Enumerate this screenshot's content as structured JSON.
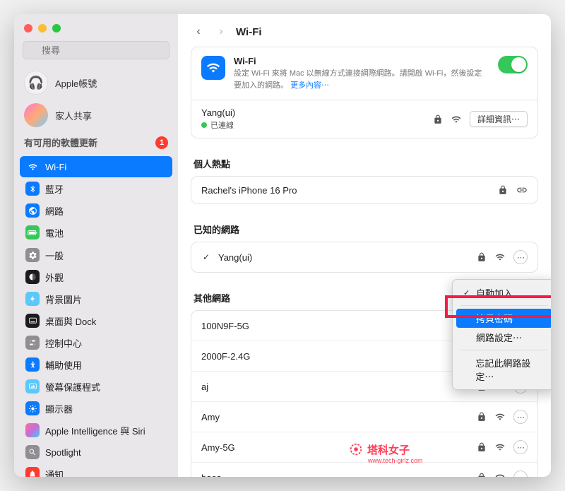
{
  "search": {
    "placeholder": "搜尋"
  },
  "accounts": {
    "apple": "Apple帳號",
    "family": "家人共享"
  },
  "updates": {
    "label": "有可用的軟體更新",
    "count": "1"
  },
  "sidebar": {
    "wifi": "Wi-Fi",
    "bluetooth": "藍牙",
    "network": "網路",
    "battery": "電池",
    "general": "一般",
    "appearance": "外觀",
    "wallpaper": "背景圖片",
    "dock": "桌面與 Dock",
    "control": "控制中心",
    "accessibility": "輔助使用",
    "screensaver": "螢幕保護程式",
    "display": "顯示器",
    "siri": "Apple Intelligence 與 Siri",
    "spotlight": "Spotlight",
    "notifications": "通知"
  },
  "header": {
    "title": "Wi-Fi"
  },
  "hero": {
    "title": "Wi-Fi",
    "desc": "設定 Wi-Fi 來將 Mac 以無線方式連接網際網路。請開啟 Wi-Fi，然後設定要加入的網路。",
    "more": "更多內容⋯"
  },
  "current": {
    "name": "Yang(ui)",
    "status": "已連線",
    "detail_btn": "詳細資訊⋯"
  },
  "sections": {
    "hotspot": "個人熱點",
    "known": "已知的網路",
    "other": "其他網路"
  },
  "hotspot": {
    "name": "Rachel's iPhone 16 Pro"
  },
  "known": [
    {
      "name": "Yang(ui)",
      "checked": true
    }
  ],
  "other": [
    {
      "name": "100N9F-5G"
    },
    {
      "name": "2000F-2.4G"
    },
    {
      "name": "aj"
    },
    {
      "name": "Amy"
    },
    {
      "name": "Amy-5G"
    },
    {
      "name": "baos"
    }
  ],
  "menu": {
    "auto_join": "自動加入",
    "copy_password": "拷貝密碼",
    "settings": "網路設定⋯",
    "forget": "忘記此網路設定⋯"
  },
  "watermark": {
    "text": "塔科女子",
    "url": "www.tech-girlz.com"
  }
}
